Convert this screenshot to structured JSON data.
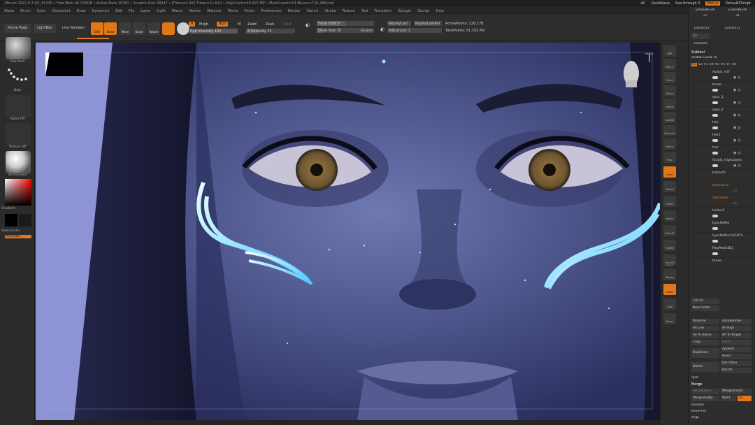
{
  "titlebar": {
    "text": "ZBrush 2022.0.7   QS_41330   • Free Mem 40.529GB • Active Mem 10767 • Scratch Disk 28047 • RTime=4.302 Timer=11.612 • PolyCount=48.927 MP • MeshCount=14  Mouse=720,286(mb)",
    "ac": "AC",
    "quicksave": "QuickSave",
    "seethrough": "See-through  0",
    "menus": "Menus",
    "script": "DefaultZScript"
  },
  "menubar": [
    "Alpha",
    "Brush",
    "Color",
    "Document",
    "Draw",
    "Dynamics",
    "Edit",
    "File",
    "Layer",
    "Light",
    "Macro",
    "Marker",
    "Material",
    "Movie",
    "Picker",
    "Preferences",
    "Render",
    "Stencil",
    "Stroke",
    "Texture",
    "Tool",
    "Transform",
    "Zplugin",
    "Zscript",
    "Help"
  ],
  "shelf": {
    "home": "Home Page",
    "lightbox": "LightBox",
    "livebool": "Live Boolean",
    "tools": [
      "Edit",
      "Draw",
      "Move",
      "Scale",
      "Rotate"
    ],
    "a": "A",
    "mrgb": "Mrgb",
    "rgb": "Rgb",
    "m": "M",
    "zadd": "Zadd",
    "zsub": "Zsub",
    "zcut": "Zcut",
    "rgb_intensity": "Rgb Intensity 100",
    "z_intensity": "Z Intensity 25",
    "focal_shift": "Focal Shift 0",
    "draw_size": "Draw Size 10",
    "dynamic": "Dynamic",
    "replay_last": "ReplayLast",
    "replay_last_rel": "ReplayLastRel",
    "adjust_last": "AdjustLast 1",
    "active_points": "ActivePoints: 120,176",
    "total_points": "TotalPoints: 51.101 Mil"
  },
  "left": {
    "standard": "Standard",
    "dots": "Dots",
    "alpha_off": "Alpha Off",
    "texture_off": "Texture Off",
    "material": "SkinShade4",
    "gradient": "Gradient",
    "switch_color": "SwitchColor",
    "alternate": "Alternate"
  },
  "rcol": [
    "BPR",
    "SPix 3",
    "Scroll",
    "Zoom",
    "Actual",
    "AAHalf",
    "Dynamic",
    "Persp",
    "Floor",
    "Local",
    "Gizmo",
    "Frame",
    "Move",
    "ZoomD",
    "Rotate",
    "Line Fill PolyF",
    "Transp",
    "Ghost",
    "Solo",
    "Xpose"
  ],
  "tray": {
    "top_brushes": [
      "SimpleBrush",
      "EraserBrush"
    ],
    "top_nums": [
      "27",
      "31"
    ],
    "extract_a": "Extract12",
    "extract_b": "Extract11",
    "extract_c": "Extract5",
    "stepper": "23",
    "subtool_title": "Subtool",
    "visible_count": "Visible Count  14",
    "vtabs": [
      "V1",
      "V2",
      "V3",
      "V4",
      "V5",
      "V6",
      "V7",
      "V8"
    ],
    "subtools": [
      "Avatar_s47",
      "brows",
      "eyes_1",
      "eyes_2",
      "hair",
      "hair1",
      "hair",
      "facial1_HighLayers",
      "Extract5",
      "Ipdtexture",
      "ToBouTour",
      "lashes2",
      "EyesReflex",
      "EyesReflex1LIGHTS",
      "PolyMesh3D1",
      "brows"
    ],
    "list_all": "List All",
    "new_folder": "New Folder",
    "actions": [
      "Rename",
      "AutoReorder",
      "All Low",
      "All High",
      "All To Home",
      "All To Target",
      "Copy",
      "Paste",
      "Duplicate",
      "Append",
      "",
      "Insert",
      "Delete",
      "Del Other",
      "",
      "Del All",
      "Split",
      "Merge",
      "MergeDown",
      "MergeSimilar",
      "MergeVisible",
      "Weld",
      "Uv",
      "Boolean",
      "Bevel Pro",
      "Align"
    ],
    "split": "Split",
    "merge": "Merge",
    "merge_down": "MergeDown",
    "merge_similar": "MergeSimilar",
    "merge_visible": "MergeVisible",
    "weld": "Weld",
    "uv": "Uv",
    "boolean": "Boolean",
    "bevel": "Bevel Pro",
    "align": "Align"
  },
  "colors": {
    "accent": "#e0781a",
    "bg": "#2b2b2b",
    "viewport": "#3a3f73"
  }
}
